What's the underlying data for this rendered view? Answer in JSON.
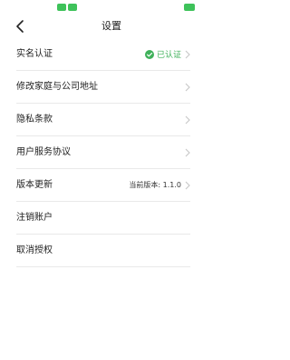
{
  "status_bar": {
    "left_pills": [
      "",
      ""
    ],
    "right_pill": "",
    "accent": "#3ec25a"
  },
  "nav": {
    "title": "设置"
  },
  "rows": [
    {
      "label": "实名认证",
      "status": "已认证"
    },
    {
      "label": "修改家庭与公司地址"
    },
    {
      "label": "隐私条款"
    },
    {
      "label": "用户服务协议"
    },
    {
      "label": "版本更新",
      "value": "当前版本: 1.1.0"
    },
    {
      "label": "注销账户"
    },
    {
      "label": "取消授权"
    }
  ],
  "colors": {
    "verified": "#3fb15a",
    "divider": "#e9e9e9",
    "chevron": "#c7c7c7"
  }
}
